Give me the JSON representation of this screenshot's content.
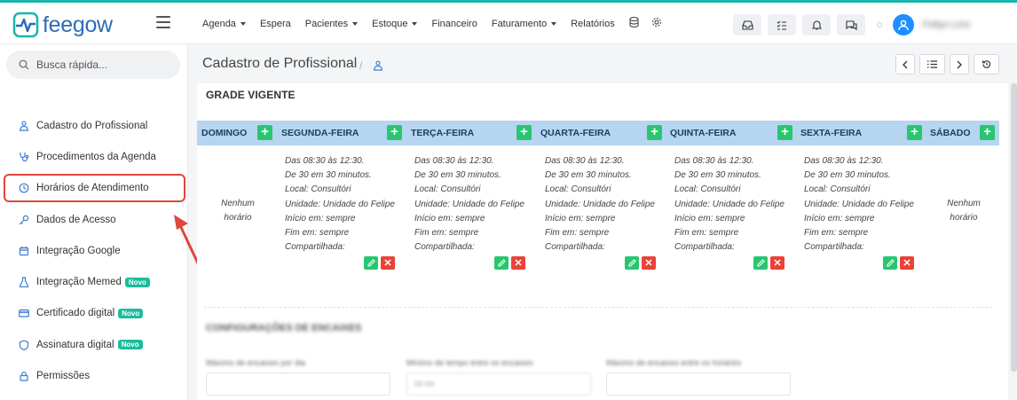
{
  "app": {
    "logo_text": "feegow"
  },
  "nav": {
    "items": [
      {
        "label": "Agenda",
        "caret": true
      },
      {
        "label": "Espera",
        "caret": false
      },
      {
        "label": "Pacientes",
        "caret": true
      },
      {
        "label": "Estoque",
        "caret": true
      },
      {
        "label": "Financeiro",
        "caret": false
      },
      {
        "label": "Faturamento",
        "caret": true
      },
      {
        "label": "Relatórios",
        "caret": false
      }
    ],
    "user_name": "Feliyo Lino"
  },
  "sidebar": {
    "search_placeholder": "Busca rápida...",
    "items": [
      {
        "label": "Cadastro do Profissional",
        "icon": "user-network-icon"
      },
      {
        "label": "Procedimentos da Agenda",
        "icon": "stethoscope-icon"
      },
      {
        "label": "Horários de Atendimento",
        "icon": "clock-icon",
        "active": true
      },
      {
        "label": "Dados de Acesso",
        "icon": "key-icon"
      },
      {
        "label": "Integração Google",
        "icon": "calendar-icon"
      },
      {
        "label": "Integração Memed",
        "icon": "flask-icon",
        "badge": "Novo"
      },
      {
        "label": "Certificado digital",
        "icon": "card-icon",
        "badge": "Novo"
      },
      {
        "label": "Assinatura digital",
        "icon": "shield-icon",
        "badge": "Novo"
      },
      {
        "label": "Permissões",
        "icon": "lock-icon"
      }
    ]
  },
  "page": {
    "title": "Cadastro de Profissional",
    "breadcrumb_sep": "/"
  },
  "grade": {
    "title": "GRADE VIGENTE",
    "none_text": "Nenhum horário",
    "days": [
      {
        "label": "DOMINGO",
        "has_schedule": false
      },
      {
        "label": "SEGUNDA-FEIRA",
        "has_schedule": true
      },
      {
        "label": "TERÇA-FEIRA",
        "has_schedule": true
      },
      {
        "label": "QUARTA-FEIRA",
        "has_schedule": true
      },
      {
        "label": "QUINTA-FEIRA",
        "has_schedule": true
      },
      {
        "label": "SEXTA-FEIRA",
        "has_schedule": true
      },
      {
        "label": "SÁBADO",
        "has_schedule": false
      }
    ],
    "schedule": {
      "time": "Das 08:30 às 12:30.",
      "interval": "De 30 em 30 minutos.",
      "local": "Local: Consultóri",
      "unidade": "Unidade: Unidade do Felipe",
      "inicio": "Início em: sempre",
      "fim": "Fim em: sempre",
      "compartilhada": "Compartilhada:"
    }
  },
  "config": {
    "title": "CONFIGURAÇÕES DE ENCAIXES",
    "fields": [
      {
        "label": "Máximo de encaixes por dia",
        "placeholder": ""
      },
      {
        "label": "Mínimo de tempo entre os encaixes",
        "placeholder": "00:00"
      },
      {
        "label": "Máximo de encaixes entre os horários",
        "placeholder": ""
      }
    ]
  },
  "colors": {
    "brand": "#2d6db5",
    "accent": "#19b6ad",
    "header_bg": "#b6d5f0",
    "success": "#28c76f",
    "danger": "#ea4335",
    "highlight": "#e0463c"
  }
}
